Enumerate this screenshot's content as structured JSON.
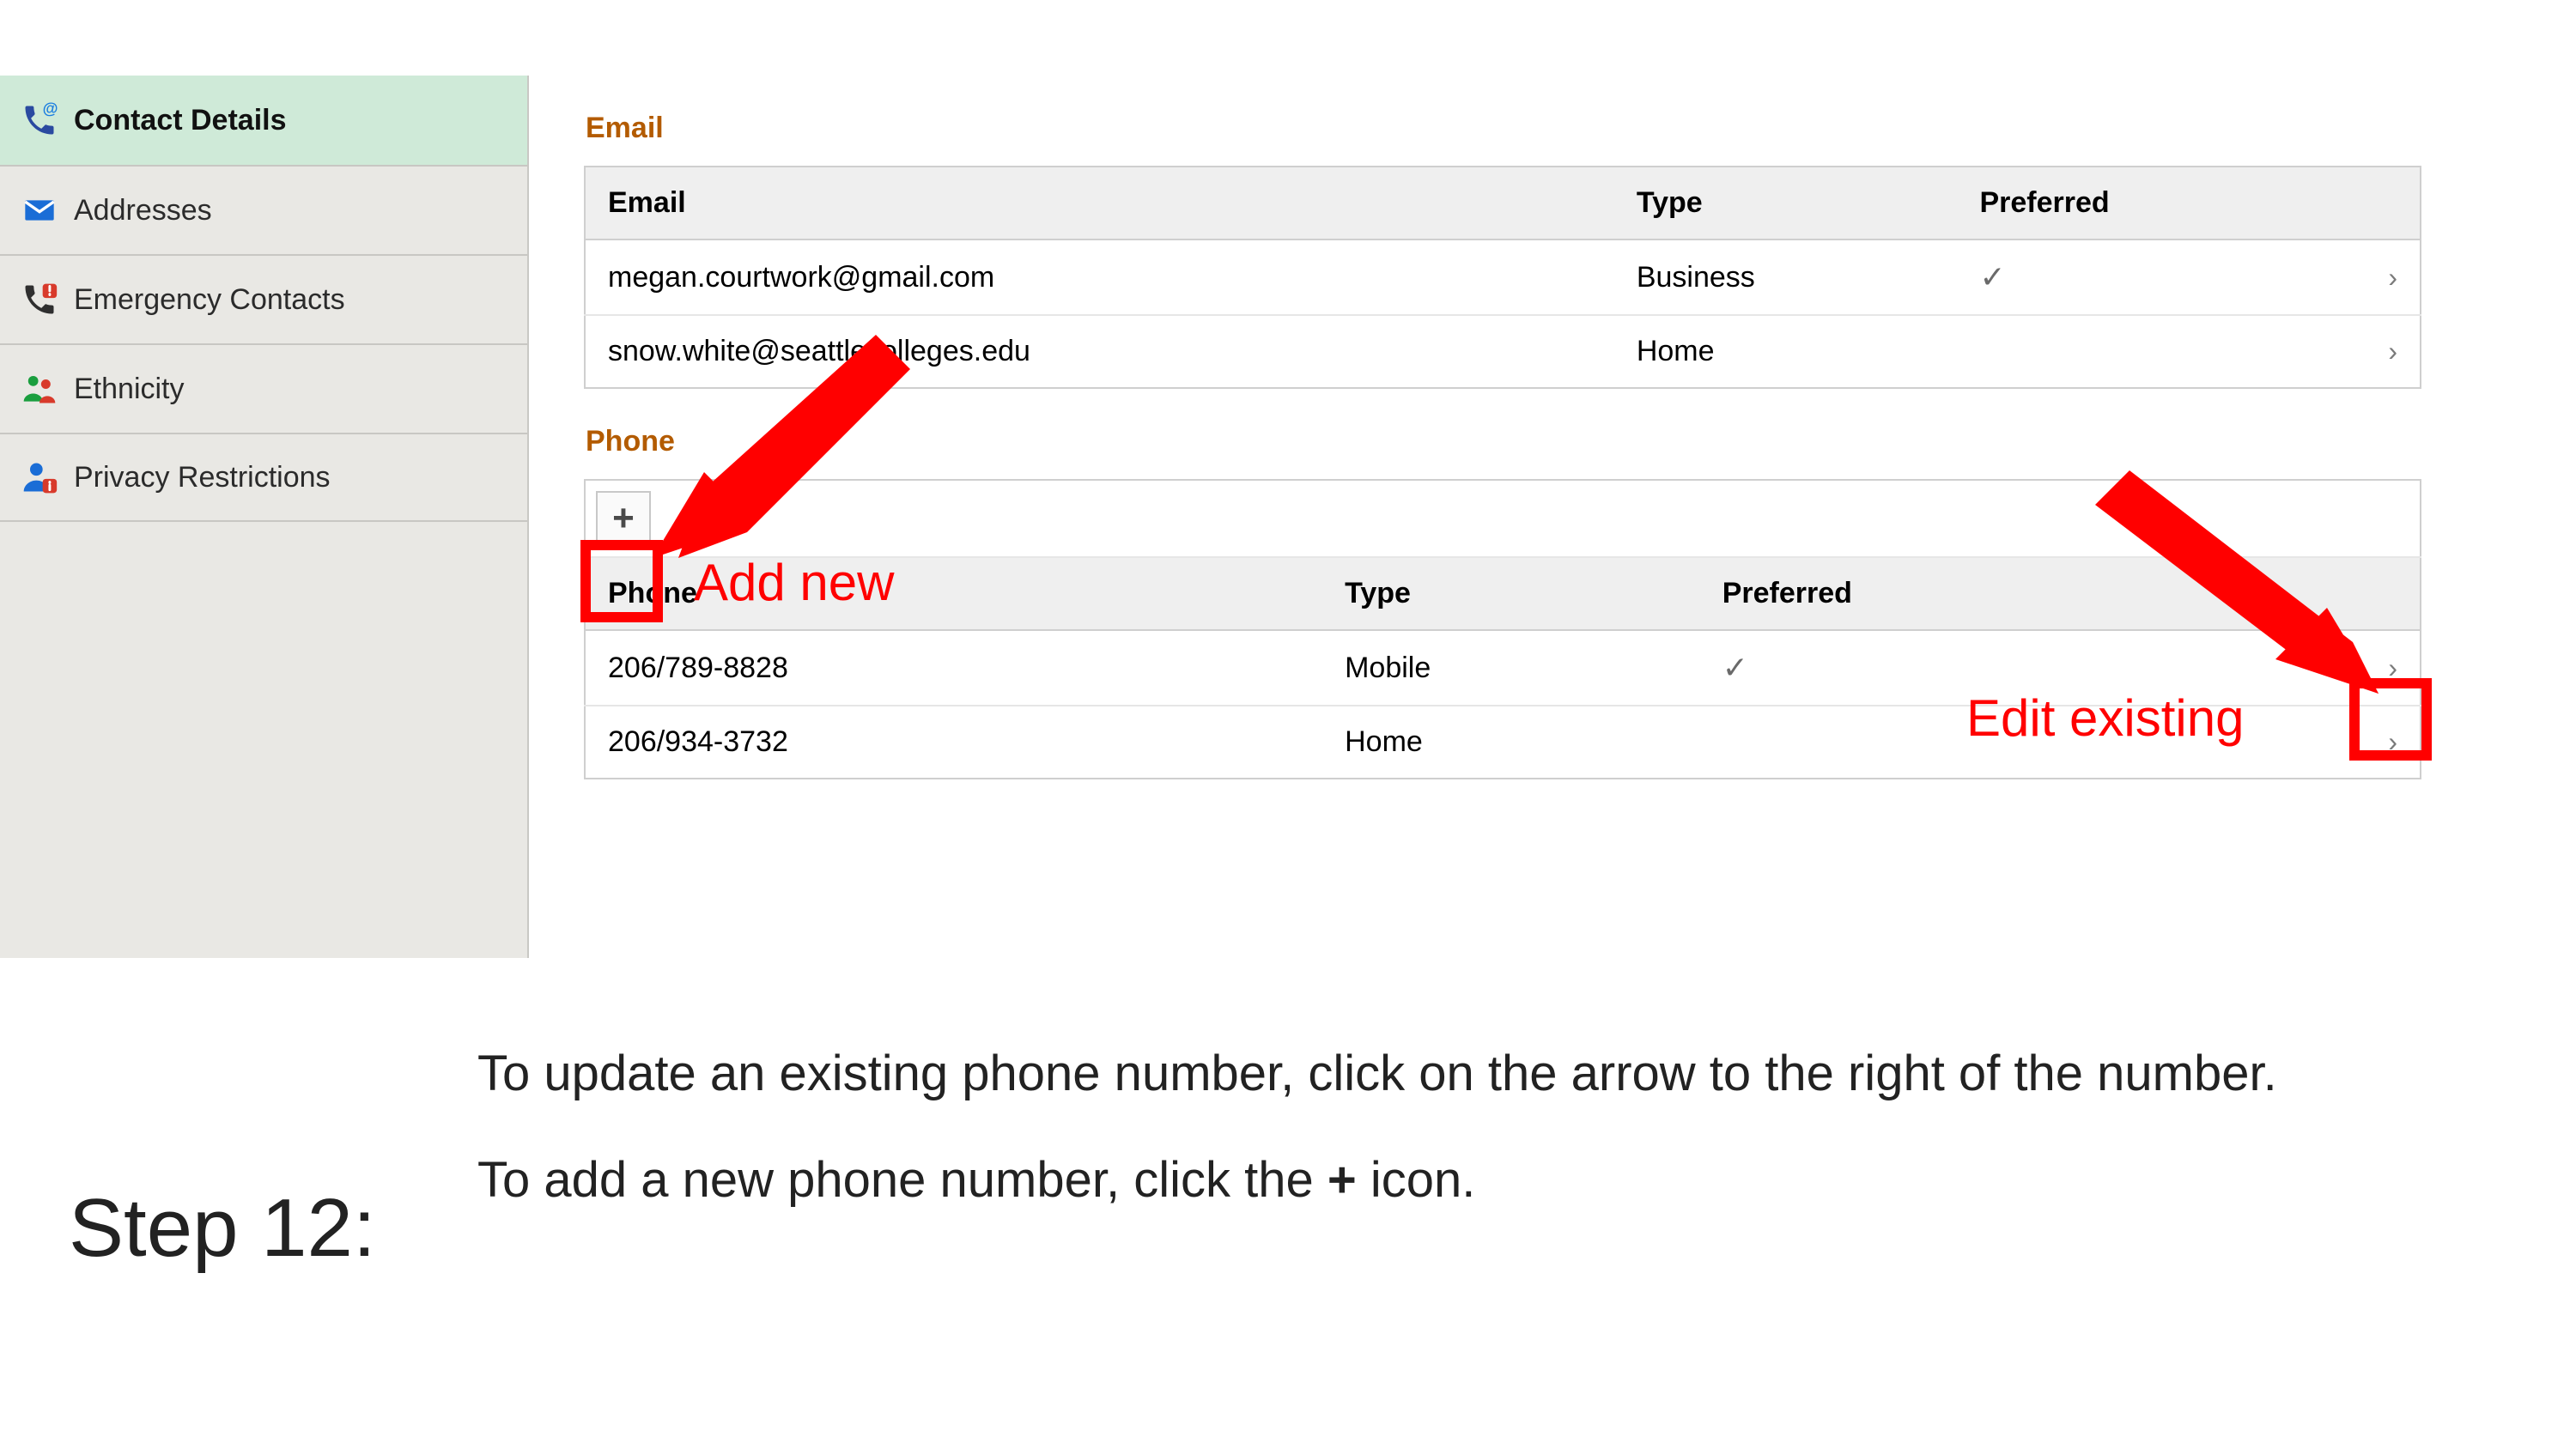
{
  "sidebar": {
    "items": [
      {
        "label": "Contact Details",
        "icon": "phone-at"
      },
      {
        "label": "Addresses",
        "icon": "envelope"
      },
      {
        "label": "Emergency Contacts",
        "icon": "phone-alert"
      },
      {
        "label": "Ethnicity",
        "icon": "people"
      },
      {
        "label": "Privacy Restrictions",
        "icon": "person-info"
      }
    ]
  },
  "content": {
    "email_section_title": "Email",
    "email_headers": {
      "main": "Email",
      "type": "Type",
      "pref": "Preferred"
    },
    "emails": [
      {
        "address": "megan.courtwork@gmail.com",
        "type": "Business",
        "preferred": true
      },
      {
        "address": "snow.white@seattlecolleges.edu",
        "type": "Home",
        "preferred": false
      }
    ],
    "phone_section_title": "Phone",
    "phone_headers": {
      "main": "Phone",
      "type": "Type",
      "pref": "Preferred"
    },
    "phones": [
      {
        "number": "206/789-8828",
        "type": "Mobile",
        "preferred": true
      },
      {
        "number": "206/934-3732",
        "type": "Home",
        "preferred": false
      }
    ]
  },
  "annotations": {
    "add_new_label": "Add new",
    "edit_existing_label": "Edit existing"
  },
  "step": {
    "label": "Step 12:",
    "line1": "To update an existing phone number, click on the arrow to the right of the number.",
    "line2_a": "To add a new phone number, click the ",
    "line2_plus": "+",
    "line2_b": " icon."
  },
  "colors": {
    "accent_section": "#b35b00",
    "annotation_red": "#ff0000",
    "sidebar_active": "#cfead8"
  }
}
